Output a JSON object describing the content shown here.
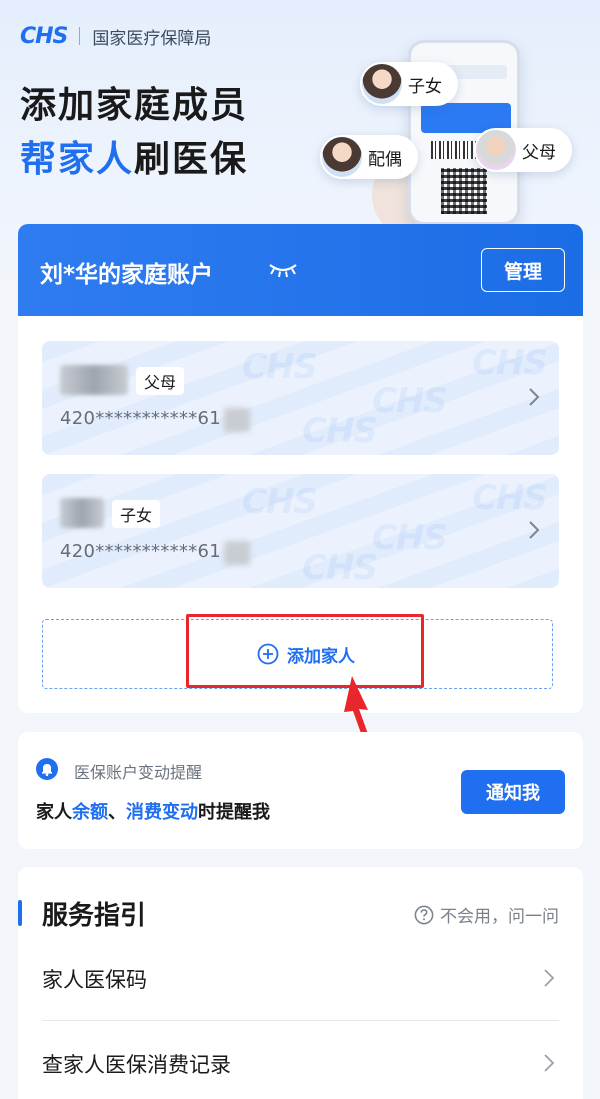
{
  "header": {
    "logo": "CHS",
    "org": "国家医疗保障局",
    "title_line1": "添加家庭成员",
    "title_line2_highlight": "帮家人",
    "title_line2_rest": "刷医保",
    "bubbles": {
      "child": "子女",
      "spouse": "配偶",
      "parent": "父母"
    }
  },
  "account": {
    "title": "刘*华的家庭账户",
    "manage_label": "管理",
    "members": [
      {
        "relation": "父母",
        "id_number": "420***********61"
      },
      {
        "relation": "子女",
        "id_number": "420***********61"
      }
    ],
    "add_label": "添加家人",
    "watermark": "CHS"
  },
  "notice": {
    "label": "医保账户变动提醒",
    "text_prefix": "家人",
    "text_hl1": "余额",
    "text_sep": "、",
    "text_hl2": "消费变动",
    "text_suffix": "时提醒我",
    "button_label": "通知我"
  },
  "guide": {
    "title": "服务指引",
    "help_label": "不会用，问一问",
    "items": [
      {
        "label": "家人医保码"
      },
      {
        "label": "查家人医保消费记录"
      }
    ]
  },
  "colors": {
    "brand_blue": "#1f6ff0",
    "annotation_red": "#e8262b"
  }
}
